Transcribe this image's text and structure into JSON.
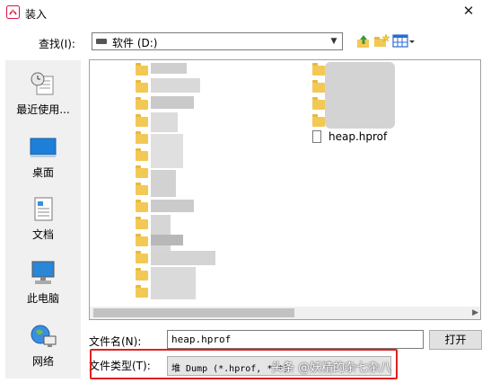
{
  "window": {
    "title": "装入"
  },
  "lookin": {
    "label": "查找(I):",
    "value": "软件 (D:)"
  },
  "places": [
    {
      "label": "最近使用..."
    },
    {
      "label": "桌面"
    },
    {
      "label": "文档"
    },
    {
      "label": "此电脑"
    },
    {
      "label": "网络"
    }
  ],
  "files": [
    {
      "name": "heap.hprof"
    }
  ],
  "filename": {
    "label": "文件名(N):",
    "value": "heap.hprof"
  },
  "filetype": {
    "label": "文件类型(T):",
    "value": "堆 Dump (*.hprof, *.*)"
  },
  "buttons": {
    "open": "打开"
  },
  "watermark": {
    "text": "头条 @妖精的杂七杂八"
  },
  "colors": {
    "highlight_box": "#e02020",
    "folder": "#f2c955"
  }
}
